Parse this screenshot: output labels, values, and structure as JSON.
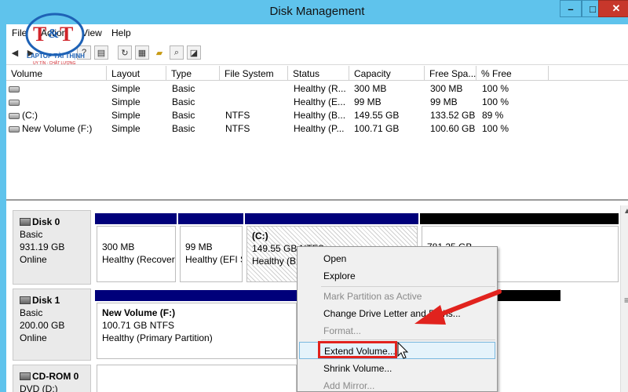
{
  "window": {
    "title": "Disk Management",
    "controls": {
      "minimize": "–",
      "maximize": "□",
      "close": "✕"
    }
  },
  "menu": {
    "items": [
      "File",
      "Action",
      "View",
      "Help"
    ]
  },
  "logo": {
    "brand": "T&T",
    "subtitle": "LAPTOP TÀI THỊNH",
    "tagline": "UY TÍN - CHẤT LƯỢNG"
  },
  "list": {
    "columns": [
      "Volume",
      "Layout",
      "Type",
      "File System",
      "Status",
      "Capacity",
      "Free Spa...",
      "% Free"
    ],
    "rows": [
      {
        "volume": "",
        "layout": "Simple",
        "type": "Basic",
        "fs": "",
        "status": "Healthy (R...",
        "capacity": "300 MB",
        "free": "300 MB",
        "pct": "100 %"
      },
      {
        "volume": "",
        "layout": "Simple",
        "type": "Basic",
        "fs": "",
        "status": "Healthy (E...",
        "capacity": "99 MB",
        "free": "99 MB",
        "pct": "100 %"
      },
      {
        "volume": "(C:)",
        "layout": "Simple",
        "type": "Basic",
        "fs": "NTFS",
        "status": "Healthy (B...",
        "capacity": "149.55 GB",
        "free": "133.52 GB",
        "pct": "89 %"
      },
      {
        "volume": "New Volume (F:)",
        "layout": "Simple",
        "type": "Basic",
        "fs": "NTFS",
        "status": "Healthy (P...",
        "capacity": "100.71 GB",
        "free": "100.60 GB",
        "pct": "100 %"
      }
    ]
  },
  "disks": [
    {
      "name": "Disk 0",
      "type": "Basic",
      "size": "931.19 GB",
      "state": "Online",
      "partitions": [
        {
          "title": "",
          "size": "300 MB",
          "status": "Healthy (Recover"
        },
        {
          "title": "",
          "size": "99 MB",
          "status": "Healthy (EFI S"
        },
        {
          "title": "(C:)",
          "size": "149.55 GB NTFS",
          "status": "Healthy (B"
        },
        {
          "title": "",
          "size": "781.25 GB",
          "status": ""
        }
      ]
    },
    {
      "name": "Disk 1",
      "type": "Basic",
      "size": "200.00 GB",
      "state": "Online",
      "partitions": [
        {
          "title": "New Volume  (F:)",
          "size": "100.71 GB NTFS",
          "status": "Healthy (Primary Partition)"
        }
      ]
    },
    {
      "name": "CD-ROM 0",
      "type": "DVD (D:)",
      "size": "",
      "state": ""
    }
  ],
  "context_menu": {
    "items": [
      {
        "label": "Open",
        "enabled": true
      },
      {
        "label": "Explore",
        "enabled": true
      },
      {
        "label": "Mark Partition as Active",
        "enabled": false
      },
      {
        "label": "Change Drive Letter and Paths...",
        "enabled": true
      },
      {
        "label": "Format...",
        "enabled": false
      },
      {
        "label": "Extend Volume...",
        "enabled": true,
        "highlighted": true
      },
      {
        "label": "Shrink Volume...",
        "enabled": true
      },
      {
        "label": "Add Mirror...",
        "enabled": false
      }
    ]
  },
  "colors": {
    "titlebar": "#5fc3ec",
    "partition_header": "#00007a",
    "unallocated_header": "#000000",
    "highlight": "#e1231e"
  }
}
